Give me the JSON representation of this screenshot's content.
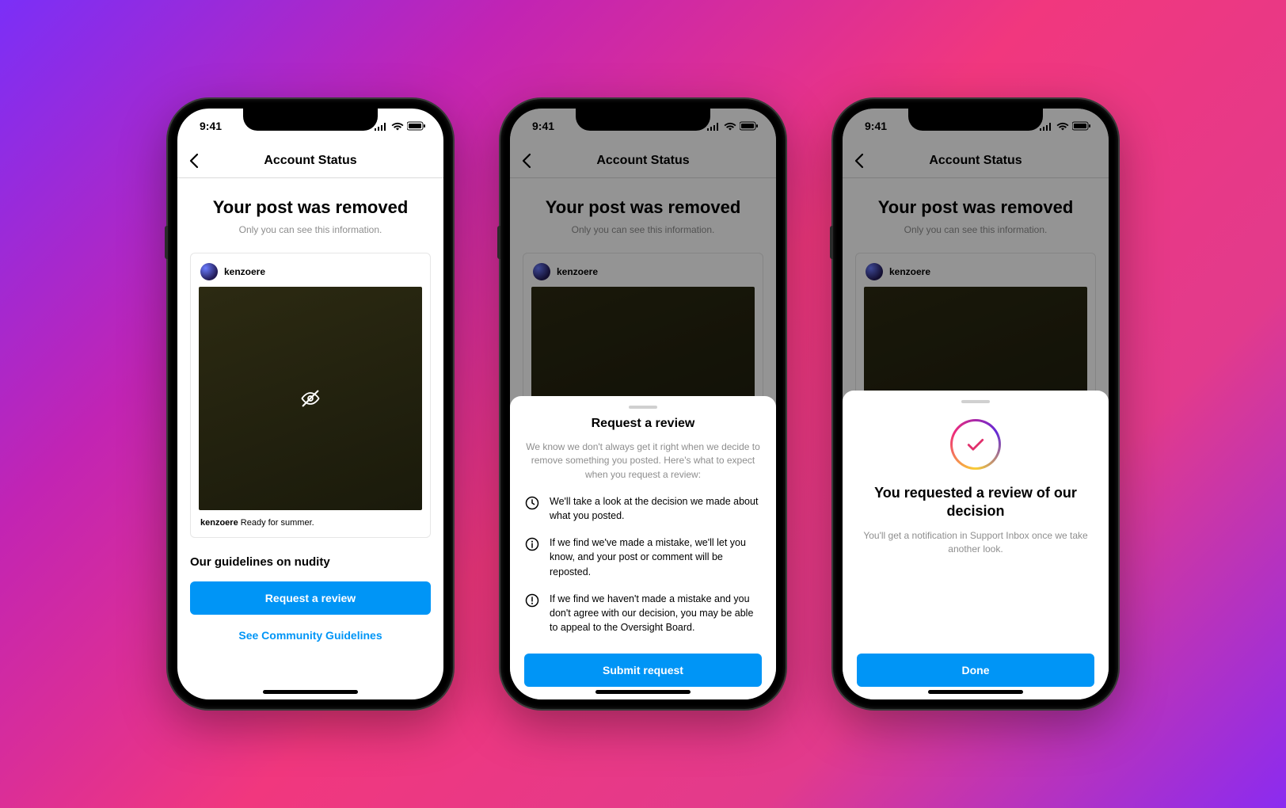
{
  "statusbar": {
    "time": "9:41"
  },
  "nav": {
    "title": "Account Status"
  },
  "main": {
    "heading": "Your post was removed",
    "subtext": "Only you can see this information.",
    "username": "kenzoere",
    "caption_user": "kenzoere",
    "caption_text": "Ready for summer.",
    "section_title": "Our guidelines on nudity",
    "btn_request": "Request a review",
    "btn_guidelines": "See Community Guidelines"
  },
  "sheet_review": {
    "title": "Request a review",
    "intro": "We know we don't always get it right when we decide to remove something you posted. Here's what to expect when you request a review:",
    "bullets": [
      "We'll take a look at the decision we made about what you posted.",
      "If we find we've made a mistake, we'll let you know, and your post or comment will be reposted.",
      "If we find we haven't made a mistake and you don't agree with our decision, you may be able to appeal to the Oversight Board."
    ],
    "btn_submit": "Submit request"
  },
  "sheet_confirm": {
    "title": "You requested a review of our decision",
    "subtext": "You'll get a notification in Support Inbox once we take another look.",
    "btn_done": "Done"
  }
}
